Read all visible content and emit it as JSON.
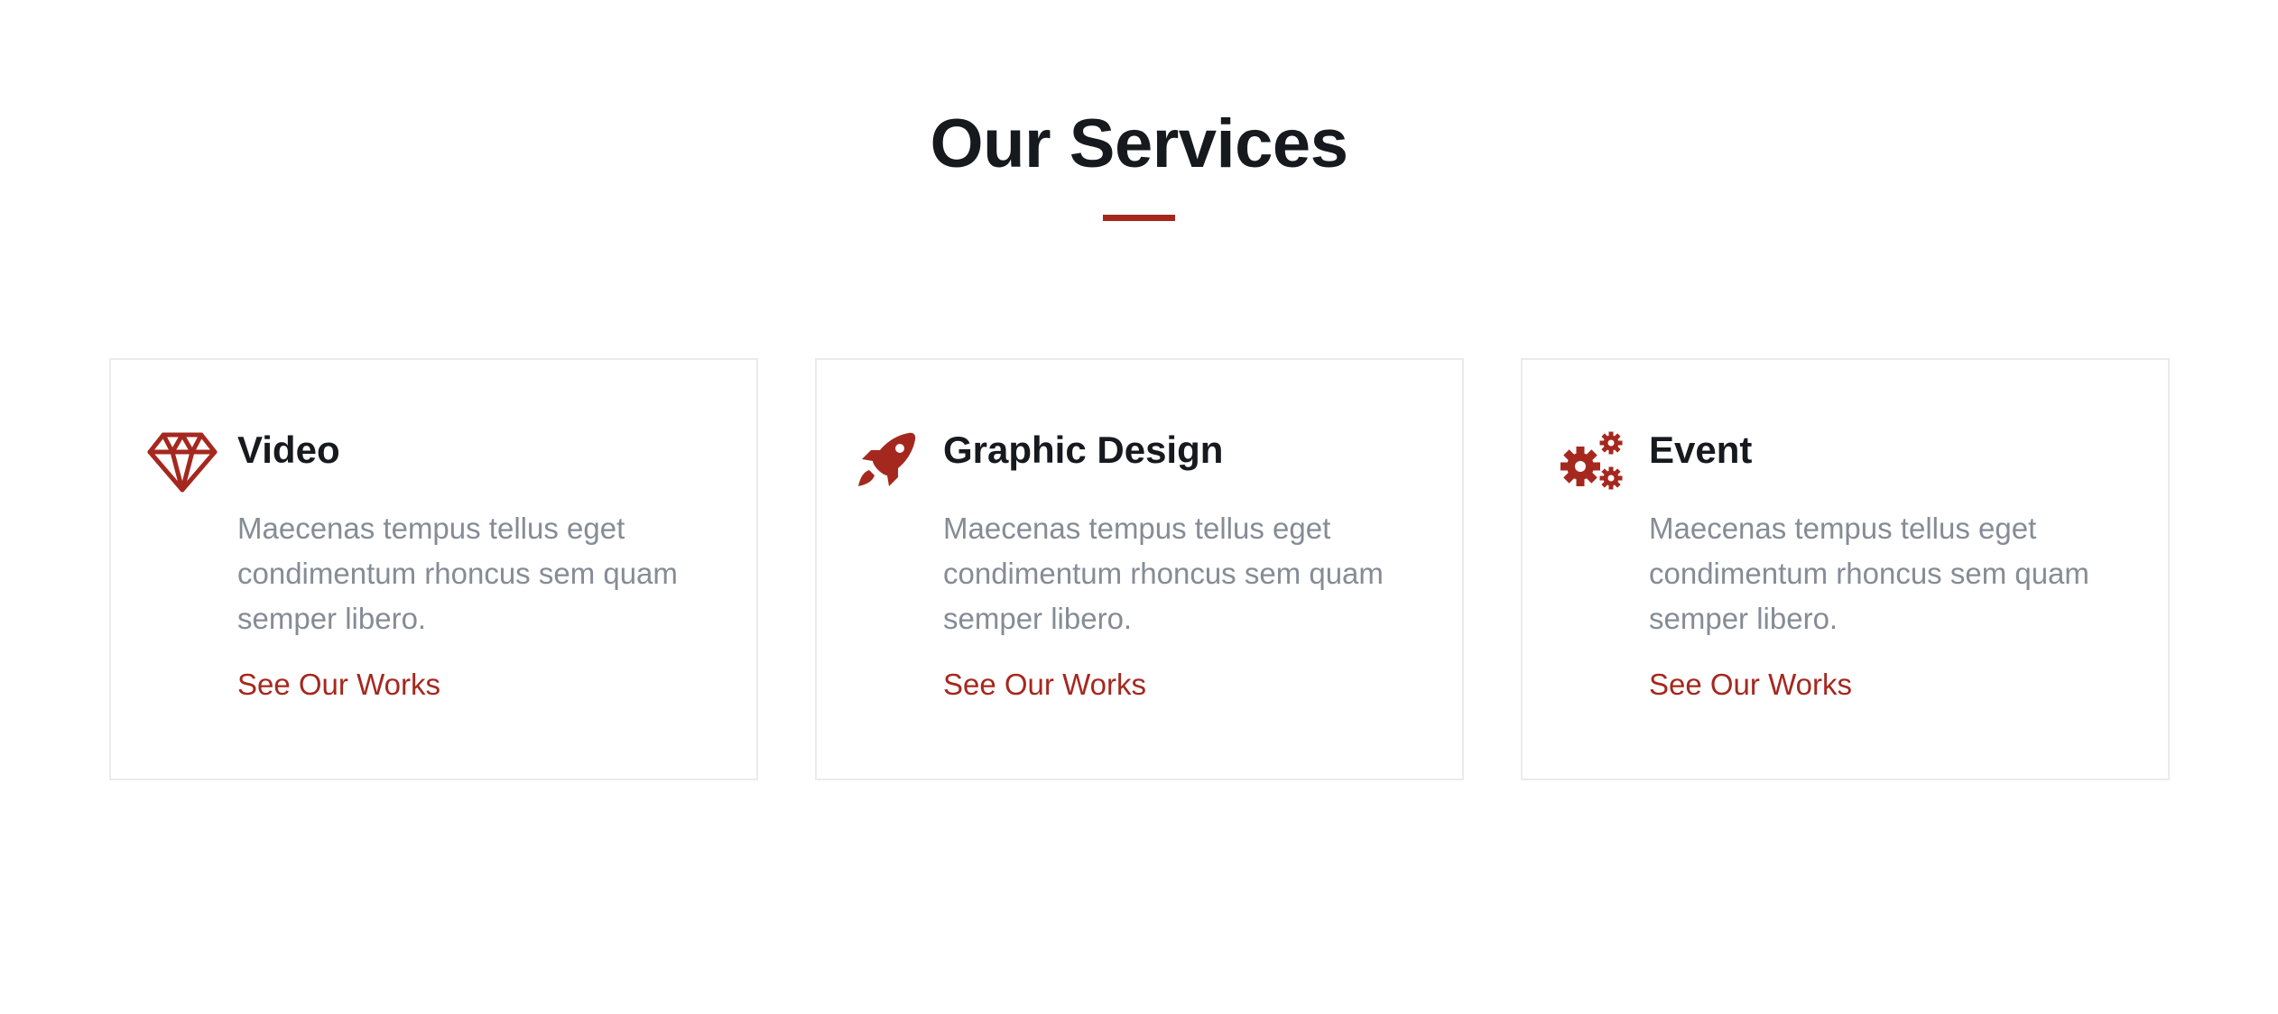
{
  "section": {
    "title": "Our Services"
  },
  "colors": {
    "accent": "#a5281f",
    "heading": "#16191d",
    "body_text": "#858c95",
    "card_border": "#ebebeb"
  },
  "services": [
    {
      "icon": "diamond-icon",
      "title": "Video",
      "description": "Maecenas tempus tellus eget condimentum rhoncus sem quam semper libero.",
      "link": "See Our Works"
    },
    {
      "icon": "rocket-icon",
      "title": "Graphic Design",
      "description": "Maecenas tempus tellus eget condimentum rhoncus sem quam semper libero.",
      "link": "See Our Works"
    },
    {
      "icon": "gears-icon",
      "title": "Event",
      "description": "Maecenas tempus tellus eget condimentum rhoncus sem quam semper libero.",
      "link": "See Our Works"
    }
  ]
}
